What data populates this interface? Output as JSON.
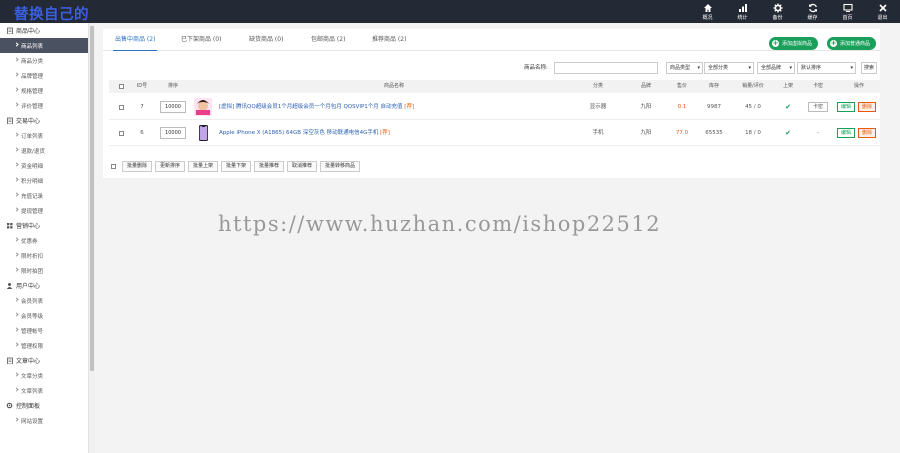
{
  "header": {
    "logo": "替换自己的",
    "nav": [
      {
        "label": "概况",
        "icon": "home-icon"
      },
      {
        "label": "统计",
        "icon": "bar-chart-icon"
      },
      {
        "label": "备份",
        "icon": "gear-icon"
      },
      {
        "label": "缓存",
        "icon": "refresh-icon"
      },
      {
        "label": "首页",
        "icon": "monitor-icon"
      },
      {
        "label": "退出",
        "icon": "close-icon"
      }
    ]
  },
  "sidebar": {
    "groups": [
      {
        "title": "商品中心",
        "icon": "doc-icon",
        "items": [
          "商品列表",
          "商品分类",
          "品牌管理",
          "规格管理",
          "评价管理"
        ]
      },
      {
        "title": "交易中心",
        "icon": "doc-icon",
        "items": [
          "订单列表",
          "退款/退货",
          "资金明细",
          "积分明细",
          "充值记录",
          "提现管理"
        ]
      },
      {
        "title": "营销中心",
        "icon": "grid-icon",
        "items": [
          "优惠券",
          "限时折扣",
          "限时拍团"
        ]
      },
      {
        "title": "用户中心",
        "icon": "user-icon",
        "items": [
          "会员列表",
          "会员等级",
          "管理帐号",
          "管理权限"
        ]
      },
      {
        "title": "文章中心",
        "icon": "doc-icon",
        "items": [
          "文章分类",
          "文章列表"
        ]
      },
      {
        "title": "控制面板",
        "icon": "gear-icon",
        "items": [
          "网站设置"
        ]
      }
    ],
    "active": "商品列表"
  },
  "tabs": [
    "出售中商品 (2)",
    "已下架商品 (0)",
    "缺货商品 (0)",
    "包邮商品 (2)",
    "推荐商品 (2)"
  ],
  "actions": {
    "add_virtual": "添加虚拟商品",
    "add_normal": "添加普通商品"
  },
  "filters": {
    "name_label": "商品名称:",
    "name_value": "",
    "type": "商品类型",
    "category": "全部分类",
    "brand": "全部品牌",
    "sort": "默认排序",
    "search": "搜索"
  },
  "columns": [
    "ID号",
    "排序",
    "商品名称",
    "分类",
    "品牌",
    "售价",
    "库存",
    "销量/评价",
    "上架",
    "卡密",
    "操作"
  ],
  "rows": [
    {
      "id": "7",
      "sort": "10000",
      "name": "[虚拟] 腾讯QQ超级会员1个月超级会员一个月包月 QQSVIP1个月 自动充值",
      "tag": "[荐]",
      "category": "显示器",
      "brand": "九阳",
      "price": "0.1",
      "stock": "9987",
      "sales": "45 / 0",
      "card": "卡密",
      "edit": "编辑",
      "del": "删除"
    },
    {
      "id": "6",
      "sort": "10000",
      "name": "Apple iPhone X (A1865) 64GB 深空灰色 移动联通电信4G手机",
      "tag": "[荐]",
      "category": "手机",
      "brand": "九阳",
      "price": "77.0",
      "stock": "65535",
      "sales": "18 / 0",
      "card": "-",
      "edit": "编辑",
      "del": "删除"
    }
  ],
  "bulk": [
    "批量删除",
    "更新排序",
    "批量上架",
    "批量下架",
    "批量推荐",
    "取消推荐",
    "批量转移商品"
  ],
  "watermark": "https://www.huzhan.com/ishop22512"
}
